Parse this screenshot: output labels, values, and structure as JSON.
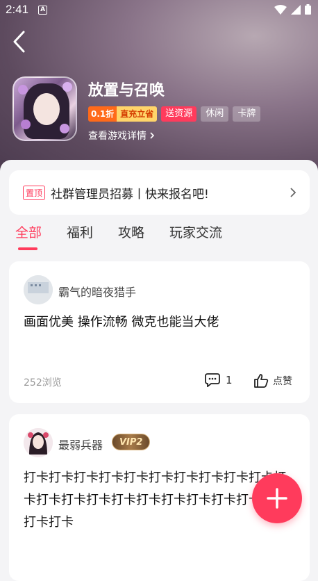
{
  "status_bar": {
    "time": "2:41",
    "notification_icon": "a-icon",
    "icons": [
      "wifi-icon",
      "signal-icon",
      "battery-icon"
    ]
  },
  "header": {
    "game_title": "放置与召唤",
    "discount": {
      "left": "0.1折",
      "right": "直充立省"
    },
    "tags": [
      "送资源",
      "休闲",
      "卡牌"
    ],
    "detail_link": "查看游戏详情"
  },
  "pinned": {
    "badge": "置顶",
    "text": "社群管理员招募丨快来报名吧!"
  },
  "tabs": [
    {
      "label": "全部",
      "active": true
    },
    {
      "label": "福利",
      "active": false
    },
    {
      "label": "攻略",
      "active": false
    },
    {
      "label": "玩家交流",
      "active": false
    }
  ],
  "posts": [
    {
      "username": "霸气的暗夜猎手",
      "text": "画面优美 操作流畅 微克也能当大佬",
      "views": "252浏览",
      "comments": "1",
      "like_label": "点赞"
    },
    {
      "username": "最弱兵器",
      "vip": "VIP2",
      "text": "打卡打卡打卡打卡打卡打卡打卡打卡打卡打卡打卡打卡打卡打卡打卡打卡打卡打卡打卡打卡打卡打卡打卡"
    }
  ],
  "colors": {
    "accent": "#ff3b5c",
    "discount_orange": "#ff6a1a",
    "discount_yellow": "#ffd56a"
  }
}
